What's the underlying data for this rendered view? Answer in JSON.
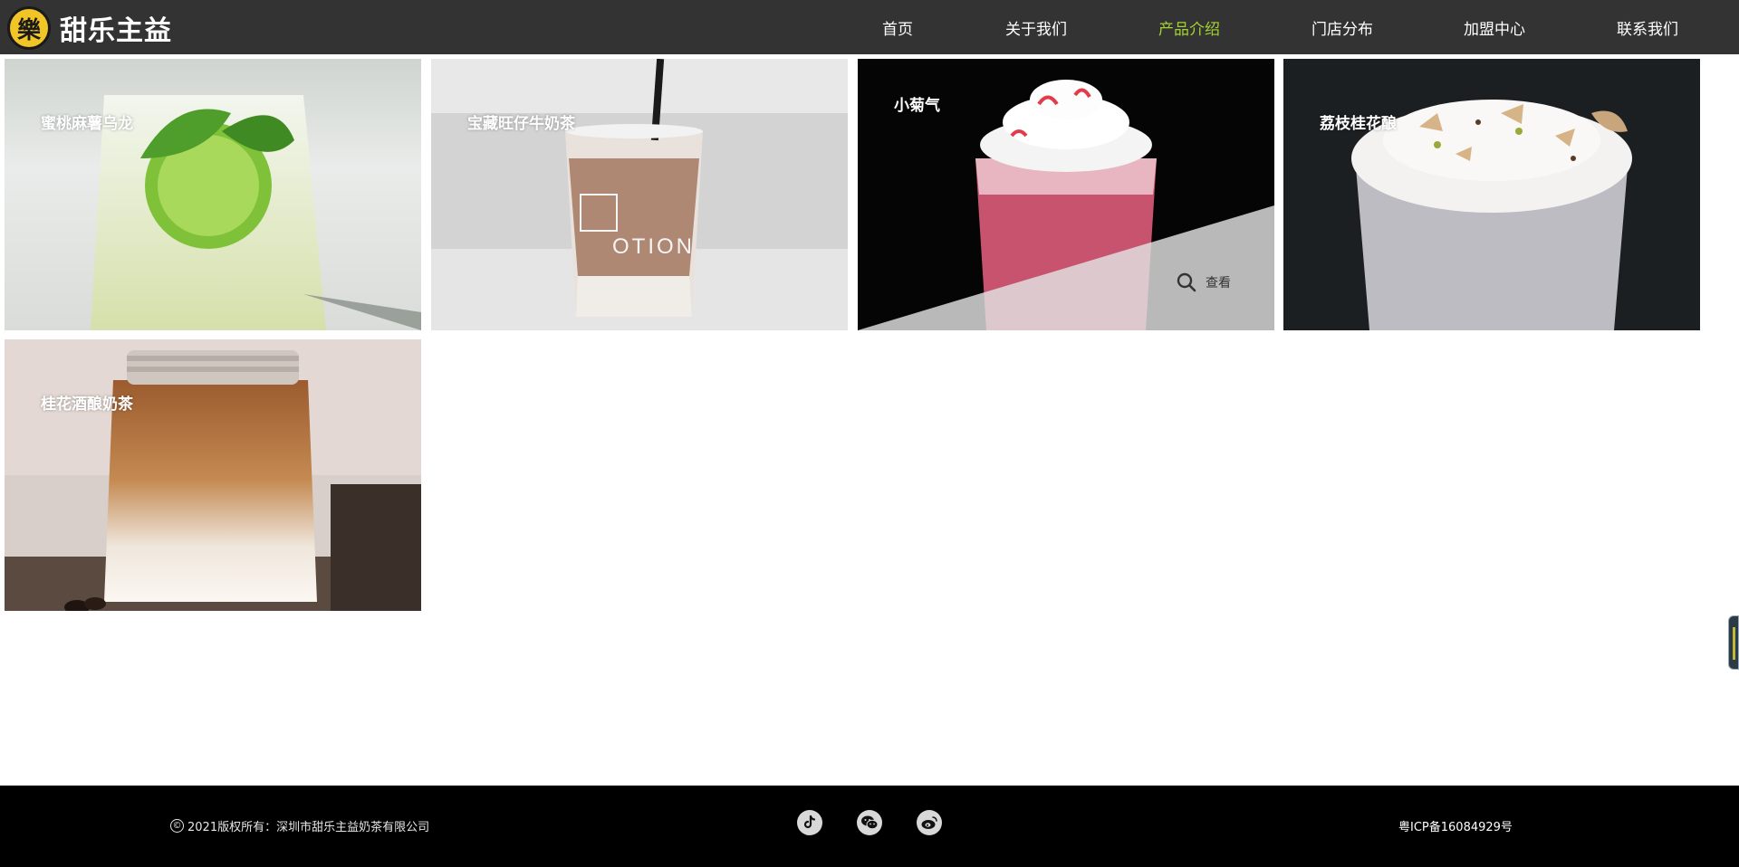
{
  "brand": {
    "logo_glyph": "樂",
    "name": "甜乐主益",
    "logo_color": "#f2c526"
  },
  "nav": {
    "items": [
      {
        "label": "首页",
        "active": false
      },
      {
        "label": "关于我们",
        "active": false
      },
      {
        "label": "产品介绍",
        "active": true
      },
      {
        "label": "门店分布",
        "active": false
      },
      {
        "label": "加盟中心",
        "active": false
      },
      {
        "label": "联系我们",
        "active": false
      }
    ],
    "active_color": "#a4d233"
  },
  "products": [
    {
      "name": "蜜桃麻薯乌龙",
      "image": "lime-mojito-glass"
    },
    {
      "name": "宝藏旺仔牛奶茶",
      "image": "iced-milk-tea-cup"
    },
    {
      "name": "小菊气",
      "image": "strawberry-cream-drink",
      "hovered": true
    },
    {
      "name": "荔枝桂花酿",
      "image": "pistachio-cream-cup"
    },
    {
      "name": "桂花酒酿奶茶",
      "image": "iced-latte-jar"
    }
  ],
  "hover": {
    "view_label": "查看",
    "view_icon": "search-icon"
  },
  "footer": {
    "copyright_symbol": "©",
    "copyright": "2021版权所有：深圳市甜乐主益奶茶有限公司",
    "social": [
      {
        "name": "douyin-icon"
      },
      {
        "name": "wechat-icon"
      },
      {
        "name": "weibo-icon"
      }
    ],
    "icp": "粤ICP备16084929号"
  }
}
